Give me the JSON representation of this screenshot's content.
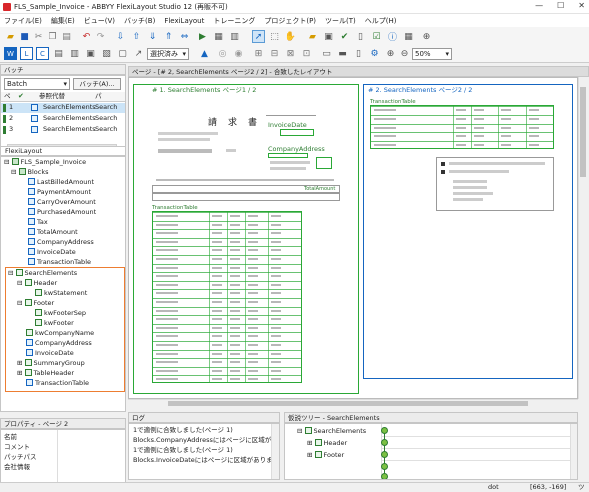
{
  "window": {
    "title": "FLS_Sample_Invoice - ABBYY FlexiLayout Studio 12 (再販不可)",
    "min": "—",
    "max": "☐",
    "close": "✕"
  },
  "menu": [
    "ファイル(E)",
    "編集(E)",
    "ビュー(V)",
    "バッチ(B)",
    "FlexiLayout",
    "トレーニング",
    "プロジェクト(P)",
    "ツール(T)",
    "ヘルプ(H)"
  ],
  "toolbar": {
    "mode_select": "選択済み",
    "zoom": "50%"
  },
  "batch_panel": {
    "title": "バッチ",
    "combo": "Batch",
    "batch_button": "バッチ(A)...",
    "columns": [
      "ペ",
      "参照代替",
      "パ"
    ],
    "rows": [
      {
        "num": "1",
        "name": "SearchElements",
        "page": "Search"
      },
      {
        "num": "2",
        "name": "SearchElements",
        "page": "Search"
      },
      {
        "num": "3",
        "name": "SearchElements",
        "page": "Search"
      }
    ]
  },
  "flexilayout_panel": {
    "tab": "FlexiLayout",
    "items": [
      {
        "label": "FLS_Sample_Invoice",
        "type": "root"
      },
      {
        "label": "Blocks",
        "type": "folder"
      },
      {
        "label": "LastBilledAmount",
        "type": "text"
      },
      {
        "label": "PaymentAmount",
        "type": "text"
      },
      {
        "label": "CarryOverAmount",
        "type": "text"
      },
      {
        "label": "PurchasedAmount",
        "type": "text"
      },
      {
        "label": "Tax",
        "type": "text"
      },
      {
        "label": "TotalAmount",
        "type": "text"
      },
      {
        "label": "CompanyAddress",
        "type": "text"
      },
      {
        "label": "InvoiceDate",
        "type": "text"
      },
      {
        "label": "TransactionTable",
        "type": "table"
      },
      {
        "label": "SearchElements",
        "type": "group"
      },
      {
        "label": "Header",
        "type": "group"
      },
      {
        "label": "kwStatement",
        "type": "element"
      },
      {
        "label": "Footer",
        "type": "group"
      },
      {
        "label": "kwFooterSep",
        "type": "element"
      },
      {
        "label": "kwFooter",
        "type": "element"
      },
      {
        "label": "kwCompanyName",
        "type": "element"
      },
      {
        "label": "CompanyAddress",
        "type": "element"
      },
      {
        "label": "InvoiceDate",
        "type": "element"
      },
      {
        "label": "SummaryGroup",
        "type": "group"
      },
      {
        "label": "TableHeader",
        "type": "group"
      },
      {
        "label": "TransactionTable",
        "type": "element"
      }
    ]
  },
  "properties_panel": {
    "title": "プロパティ - ページ 2",
    "rows": [
      "名前",
      "コメント",
      "パッチパス",
      "会社情報"
    ]
  },
  "page_view": {
    "title": "ページ - [# 2, SearchElements ページ2 / 2] - 合致したレイアウト",
    "left_caption": "# 1. SearchElements ページ1 / 2",
    "right_caption": "# 2. SearchElements ページ2 / 2",
    "doc_title": "請　求　書",
    "labels": {
      "invoice_date": "InvoiceDate",
      "company_address": "CompanyAddress",
      "transaction_table": "TransactionTable",
      "transaction_table_right": "TransactionTable",
      "total_amount": "TotalAmount"
    }
  },
  "log_panel": {
    "title": "ログ",
    "lines": [
      "1で適例に合致しました(ページ 1)",
      "Blocks.CompanyAddressにはページに区域がありま",
      "1で適例に合致しました(ページ 1)",
      "Blocks.InvoiceDateにはページに区域がありま"
    ]
  },
  "hypothesis_panel": {
    "title": "仮説ツリー - SearchElements",
    "items": [
      "SearchElements",
      "Header",
      "Footer"
    ]
  },
  "statusbar": {
    "mode": "dot",
    "coords": "[663, -169]",
    "extra": "ツ"
  }
}
